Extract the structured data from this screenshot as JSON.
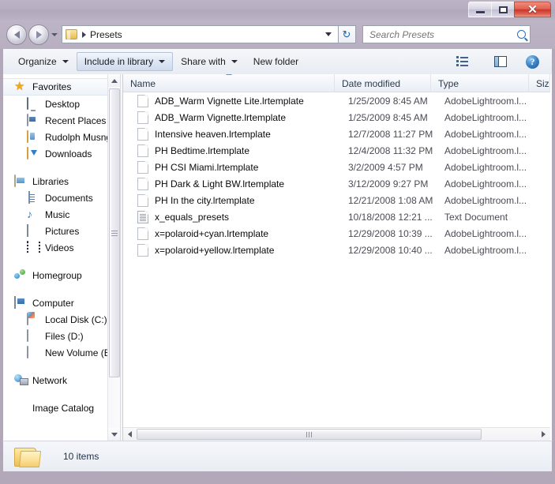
{
  "window": {
    "controls": {
      "minimize_label": "Minimize",
      "maximize_label": "Maximize",
      "close_label": "✕"
    }
  },
  "address_bar": {
    "back_label": "Back",
    "forward_label": "Forward",
    "history_label": "Recent pages",
    "folder_icon": "folder-icon",
    "path_separator": "▸",
    "path_text": "Presets",
    "dropdown_label": "Previous locations",
    "refresh_label": "↻"
  },
  "search": {
    "placeholder": "Search Presets",
    "value": "",
    "icon": "search-icon"
  },
  "command_bar": {
    "items": [
      {
        "label": "Organize",
        "has_dropdown": true,
        "active": false
      },
      {
        "label": "Include in library",
        "has_dropdown": true,
        "active": true
      },
      {
        "label": "Share with",
        "has_dropdown": true,
        "active": false
      },
      {
        "label": "New folder",
        "has_dropdown": false,
        "active": false
      }
    ],
    "view_button_label": "Change your view",
    "preview_pane_label": "Show the preview pane",
    "help_label": "?"
  },
  "navigation_pane": {
    "groups": [
      {
        "root": {
          "label": "Favorites",
          "icon": "star-icon",
          "selected": true
        },
        "children": [
          {
            "label": "Desktop",
            "icon": "desktop-icon"
          },
          {
            "label": "Recent Places",
            "icon": "recent-places-icon"
          },
          {
            "label": "Rudolph Musngi",
            "icon": "user-folder-icon"
          },
          {
            "label": "Downloads",
            "icon": "downloads-icon"
          }
        ]
      },
      {
        "root": {
          "label": "Libraries",
          "icon": "libraries-icon",
          "selected": false
        },
        "children": [
          {
            "label": "Documents",
            "icon": "documents-icon"
          },
          {
            "label": "Music",
            "icon": "music-icon"
          },
          {
            "label": "Pictures",
            "icon": "pictures-icon"
          },
          {
            "label": "Videos",
            "icon": "videos-icon"
          }
        ]
      },
      {
        "root": {
          "label": "Homegroup",
          "icon": "homegroup-icon",
          "selected": false
        },
        "children": []
      },
      {
        "root": {
          "label": "Computer",
          "icon": "computer-icon",
          "selected": false
        },
        "children": [
          {
            "label": "Local Disk (C:)",
            "icon": "system-disk-icon"
          },
          {
            "label": "Files (D:)",
            "icon": "disk-icon"
          },
          {
            "label": "New Volume (E:)",
            "icon": "disk-icon"
          }
        ]
      },
      {
        "root": {
          "label": "Network",
          "icon": "network-icon",
          "selected": false
        },
        "children": []
      },
      {
        "root": {
          "label": "Image Catalog",
          "icon": "image-catalog-icon",
          "selected": false
        },
        "children": []
      }
    ]
  },
  "file_list": {
    "columns": [
      {
        "label": "Name",
        "sorted": true,
        "sort_direction": "asc"
      },
      {
        "label": "Date modified",
        "sorted": false
      },
      {
        "label": "Type",
        "sorted": false
      },
      {
        "label": "Siz",
        "sorted": false
      }
    ],
    "rows": [
      {
        "name": "ADB_Warm Vignette Lite.lrtemplate",
        "date": "1/25/2009 8:45 AM",
        "type": "AdobeLightroom.l...",
        "icon": "lrtemplate-file-icon"
      },
      {
        "name": "ADB_Warm Vignette.lrtemplate",
        "date": "1/25/2009 8:45 AM",
        "type": "AdobeLightroom.l...",
        "icon": "lrtemplate-file-icon"
      },
      {
        "name": "Intensive heaven.lrtemplate",
        "date": "12/7/2008 11:27 PM",
        "type": "AdobeLightroom.l...",
        "icon": "lrtemplate-file-icon"
      },
      {
        "name": "PH Bedtime.lrtemplate",
        "date": "12/4/2008 11:32 PM",
        "type": "AdobeLightroom.l...",
        "icon": "lrtemplate-file-icon"
      },
      {
        "name": "PH CSI Miami.lrtemplate",
        "date": "3/2/2009 4:57 PM",
        "type": "AdobeLightroom.l...",
        "icon": "lrtemplate-file-icon"
      },
      {
        "name": "PH Dark & Light BW.lrtemplate",
        "date": "3/12/2009 9:27 PM",
        "type": "AdobeLightroom.l...",
        "icon": "lrtemplate-file-icon"
      },
      {
        "name": "PH In the city.lrtemplate",
        "date": "12/21/2008 1:08 AM",
        "type": "AdobeLightroom.l...",
        "icon": "lrtemplate-file-icon"
      },
      {
        "name": "x_equals_presets",
        "date": "10/18/2008 12:21 ...",
        "type": "Text Document",
        "icon": "text-document-icon"
      },
      {
        "name": "x=polaroid+cyan.lrtemplate",
        "date": "12/29/2008 10:39 ...",
        "type": "AdobeLightroom.l...",
        "icon": "lrtemplate-file-icon"
      },
      {
        "name": "x=polaroid+yellow.lrtemplate",
        "date": "12/29/2008 10:40 ...",
        "type": "AdobeLightroom.l...",
        "icon": "lrtemplate-file-icon"
      }
    ]
  },
  "status_bar": {
    "item_count_text": "10 items",
    "folder_icon": "folder-icon"
  }
}
